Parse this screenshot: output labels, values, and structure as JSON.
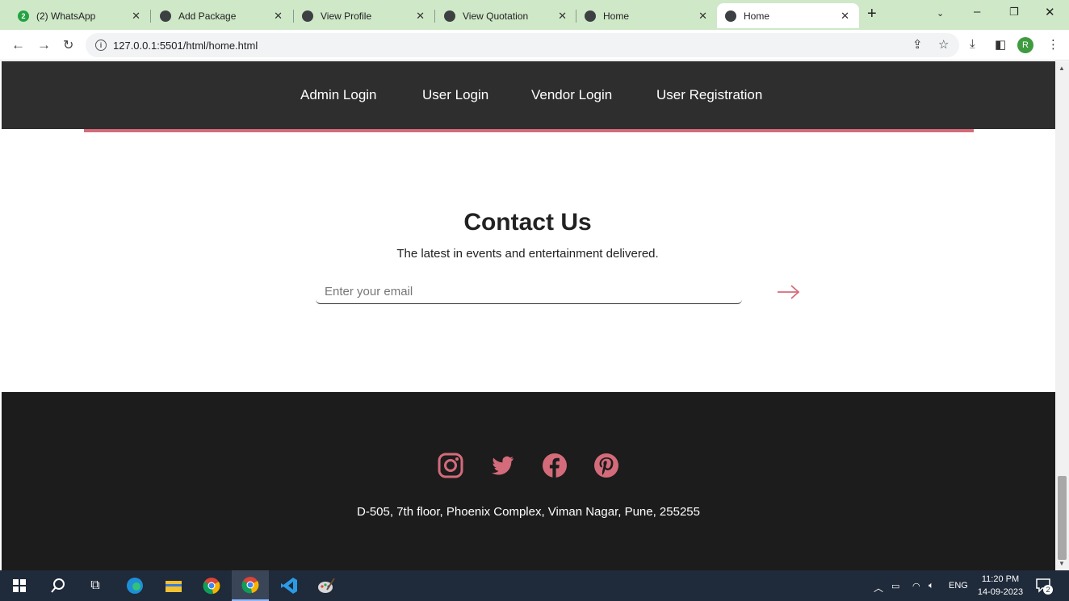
{
  "browser": {
    "tabs": [
      {
        "title": "(2) WhatsApp",
        "favicon": "whatsapp-icon",
        "badge": "2"
      },
      {
        "title": "Add Package",
        "favicon": "globe-icon"
      },
      {
        "title": "View Profile",
        "favicon": "globe-icon"
      },
      {
        "title": "View Quotation",
        "favicon": "globe-icon"
      },
      {
        "title": "Home",
        "favicon": "globe-icon"
      },
      {
        "title": "Home",
        "favicon": "globe-icon",
        "active": true
      }
    ],
    "url": "127.0.0.1:5501/html/home.html",
    "profile_initial": "R"
  },
  "site": {
    "nav": [
      "Admin Login",
      "User Login",
      "Vendor Login",
      "User Registration"
    ],
    "contact": {
      "title": "Contact Us",
      "subtitle": "The latest in events and entertainment delivered.",
      "email_placeholder": "Enter your email"
    },
    "footer": {
      "social": [
        "instagram-icon",
        "twitter-icon",
        "facebook-icon",
        "pinterest-icon"
      ],
      "address": "D-505, 7th floor, Phoenix Complex, Viman Nagar, Pune, 255255"
    }
  },
  "taskbar": {
    "language": "ENG",
    "time": "11:20 PM",
    "date": "14-09-2023",
    "notifications": "2"
  },
  "colors": {
    "accent": "#d46b7a",
    "nav_bg": "#2e2e2e",
    "footer_bg": "#1c1c1c",
    "tabbar_bg": "#cfe8c8"
  }
}
